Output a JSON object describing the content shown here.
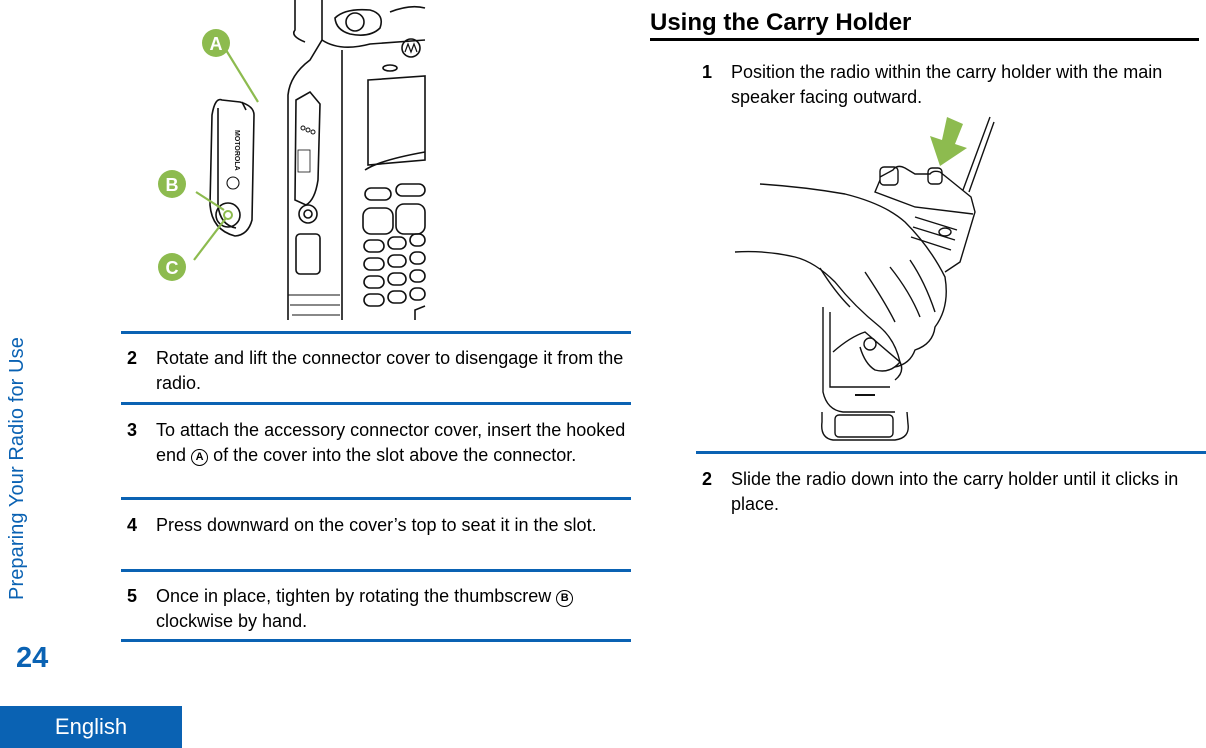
{
  "sidebar": {
    "chapter_title": "Preparing Your Radio for Use",
    "page_number": "24",
    "language_tab": "English"
  },
  "left_column": {
    "figure": {
      "callouts": [
        "A",
        "B",
        "C"
      ],
      "callout_color": "#8dbb4f"
    },
    "steps": [
      {
        "number": "2",
        "text": "Rotate and lift the connector cover to disengage it from the radio."
      },
      {
        "number": "3",
        "text_before": "To attach the accessory connector cover, insert the hooked end",
        "ref": "A",
        "text_after": "of the cover into the slot above the connector."
      },
      {
        "number": "4",
        "text": "Press downward on the cover’s top to seat it in the slot."
      },
      {
        "number": "5",
        "text_before": "Once in place, tighten by rotating the thumbscrew",
        "ref": "B",
        "text_after": "clockwise by hand."
      }
    ]
  },
  "right_column": {
    "heading": "Using the Carry Holder",
    "steps": [
      {
        "number": "1",
        "text": "Position the radio within the carry holder with the main speaker facing outward."
      },
      {
        "number": "2",
        "text": "Slide the radio down into the carry holder until it clicks in place."
      }
    ],
    "figure": {
      "arrow_color": "#8dbb4f"
    }
  },
  "colors": {
    "accent_blue": "#0a62b3",
    "callout_green": "#8dbb4f"
  }
}
